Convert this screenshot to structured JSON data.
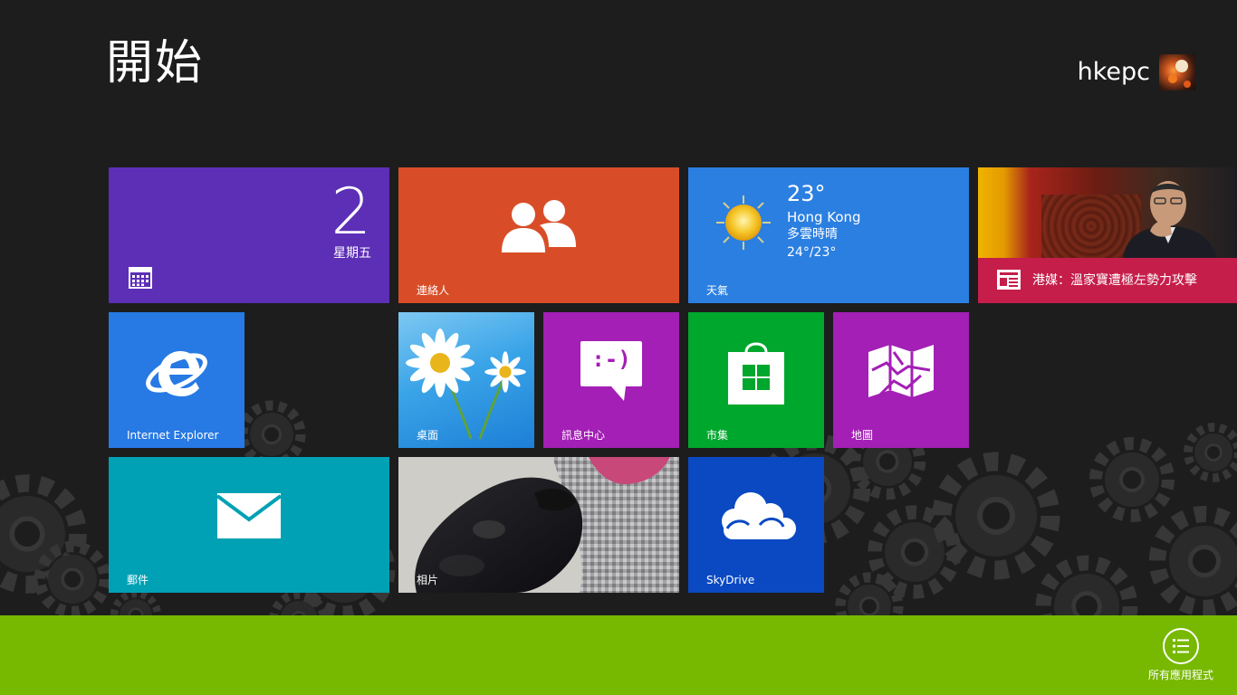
{
  "start": {
    "title": "開始",
    "user": {
      "name": "hkepc"
    }
  },
  "tiles": {
    "calendar": {
      "day": "2",
      "weekday": "星期五"
    },
    "contacts": {
      "label": "連絡人"
    },
    "weather": {
      "temp": "23°",
      "city": "Hong Kong",
      "condition": "多雲時晴",
      "range": "24°/23°",
      "label": "天氣"
    },
    "news": {
      "headline": "港媒：溫家寶遭極左勢力攻擊"
    },
    "ie": {
      "label": "Internet Explorer"
    },
    "desktop": {
      "label": "桌面"
    },
    "messaging": {
      "label": "訊息中心",
      "emoticon": ":-)"
    },
    "store": {
      "label": "市集"
    },
    "maps": {
      "label": "地圖"
    },
    "mail": {
      "label": "郵件"
    },
    "photos": {
      "label": "相片"
    },
    "skydrive": {
      "label": "SkyDrive"
    }
  },
  "appbar": {
    "all_apps_label": "所有應用程式"
  },
  "colors": {
    "background": "#1d1d1d",
    "calendar": "#5d2fb6",
    "contacts": "#d84d27",
    "weather": "#2b7fe1",
    "news": "#c51e4a",
    "ie": "#2779e4",
    "messaging": "#a31fb5",
    "store": "#00a72d",
    "maps": "#a31fb5",
    "mail": "#00a1b4",
    "skydrive": "#0b49c2",
    "appbar": "#77b800"
  }
}
